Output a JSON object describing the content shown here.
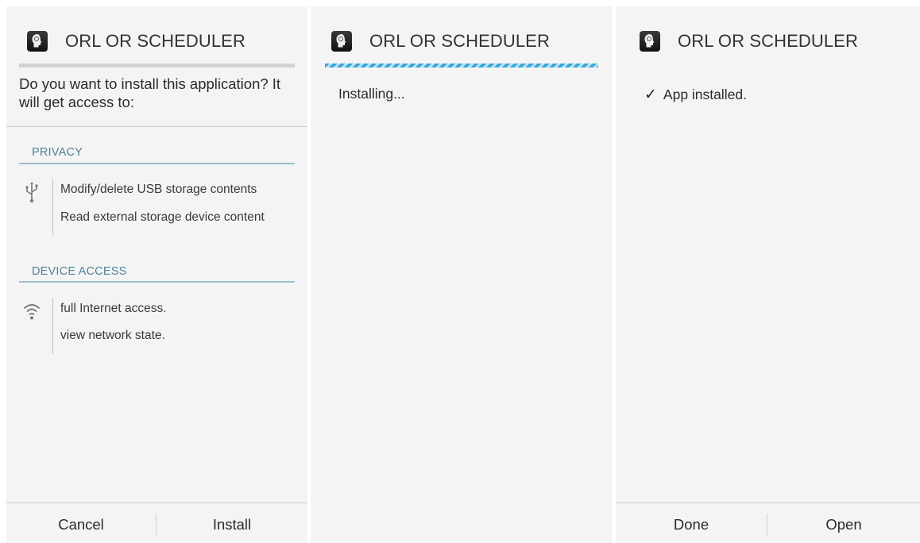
{
  "app": {
    "title": "ORL OR SCHEDULER",
    "icon": "medical-head-icon"
  },
  "install_screen": {
    "question": "Do you want to install this application? It will get access to:",
    "sections": [
      {
        "label": "PRIVACY",
        "icon": "usb-icon",
        "items": [
          "Modify/delete USB storage contents",
          "Read external storage device content"
        ]
      },
      {
        "label": "DEVICE ACCESS",
        "icon": "wifi-icon",
        "items": [
          "full Internet access.",
          "view network state."
        ]
      }
    ],
    "buttons": {
      "cancel": "Cancel",
      "install": "Install"
    }
  },
  "installing_screen": {
    "status": "Installing..."
  },
  "installed_screen": {
    "status": "App installed.",
    "status_icon": "checkmark-icon",
    "buttons": {
      "done": "Done",
      "open": "Open"
    }
  },
  "colors": {
    "accent": "#4f8296",
    "progress": "#38a8d8",
    "background": "#f4f4f4"
  }
}
